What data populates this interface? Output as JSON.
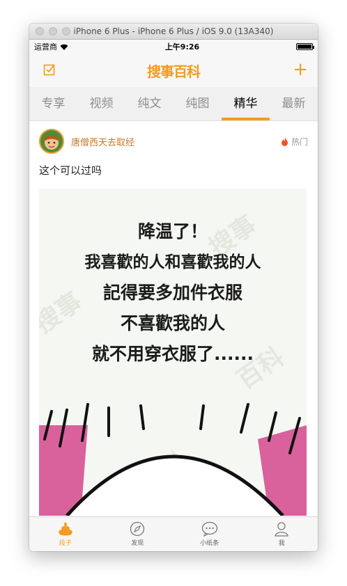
{
  "window": {
    "title": "iPhone 6 Plus - iPhone 6 Plus / iOS 9.0 (13A340)"
  },
  "statusbar": {
    "carrier": "运营商",
    "time": "上午9:26",
    "battery_level": 1.0
  },
  "navbar": {
    "logo": "搜事百科",
    "post_icon": "compose-icon",
    "add_icon": "plus-icon"
  },
  "tabs": [
    {
      "label": "专享",
      "active": false
    },
    {
      "label": "视频",
      "active": false
    },
    {
      "label": "纯文",
      "active": false
    },
    {
      "label": "纯图",
      "active": false
    },
    {
      "label": "精华",
      "active": true
    },
    {
      "label": "最新",
      "active": false
    }
  ],
  "post": {
    "username": "唐僧西天去取经",
    "badge": "热门",
    "text": "这个可以过吗",
    "image_lines": [
      "降温了！",
      "我喜歡的人和喜歡我的人",
      "記得要多加件衣服",
      "不喜歡我的人",
      "就不用穿衣服了......"
    ]
  },
  "tabbar": [
    {
      "label": "段子",
      "icon": "poop-icon",
      "active": true
    },
    {
      "label": "发现",
      "icon": "compass-icon",
      "active": false
    },
    {
      "label": "小纸条",
      "icon": "chat-icon",
      "active": false
    },
    {
      "label": "我",
      "icon": "user-icon",
      "active": false
    }
  ],
  "colors": {
    "accent": "#f39c1f",
    "username": "#c57a2a"
  }
}
